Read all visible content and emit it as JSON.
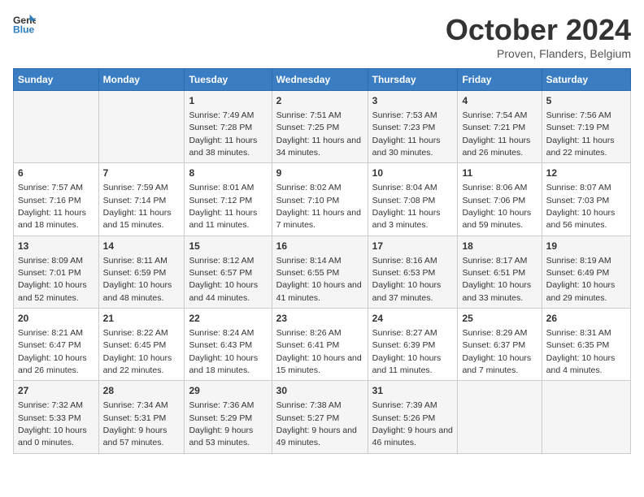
{
  "header": {
    "logo": {
      "general": "General",
      "blue": "Blue"
    },
    "month": "October 2024",
    "location": "Proven, Flanders, Belgium"
  },
  "weekdays": [
    "Sunday",
    "Monday",
    "Tuesday",
    "Wednesday",
    "Thursday",
    "Friday",
    "Saturday"
  ],
  "weeks": [
    [
      {
        "day": "",
        "info": ""
      },
      {
        "day": "",
        "info": ""
      },
      {
        "day": "1",
        "info": "Sunrise: 7:49 AM\nSunset: 7:28 PM\nDaylight: 11 hours and 38 minutes."
      },
      {
        "day": "2",
        "info": "Sunrise: 7:51 AM\nSunset: 7:25 PM\nDaylight: 11 hours and 34 minutes."
      },
      {
        "day": "3",
        "info": "Sunrise: 7:53 AM\nSunset: 7:23 PM\nDaylight: 11 hours and 30 minutes."
      },
      {
        "day": "4",
        "info": "Sunrise: 7:54 AM\nSunset: 7:21 PM\nDaylight: 11 hours and 26 minutes."
      },
      {
        "day": "5",
        "info": "Sunrise: 7:56 AM\nSunset: 7:19 PM\nDaylight: 11 hours and 22 minutes."
      }
    ],
    [
      {
        "day": "6",
        "info": "Sunrise: 7:57 AM\nSunset: 7:16 PM\nDaylight: 11 hours and 18 minutes."
      },
      {
        "day": "7",
        "info": "Sunrise: 7:59 AM\nSunset: 7:14 PM\nDaylight: 11 hours and 15 minutes."
      },
      {
        "day": "8",
        "info": "Sunrise: 8:01 AM\nSunset: 7:12 PM\nDaylight: 11 hours and 11 minutes."
      },
      {
        "day": "9",
        "info": "Sunrise: 8:02 AM\nSunset: 7:10 PM\nDaylight: 11 hours and 7 minutes."
      },
      {
        "day": "10",
        "info": "Sunrise: 8:04 AM\nSunset: 7:08 PM\nDaylight: 11 hours and 3 minutes."
      },
      {
        "day": "11",
        "info": "Sunrise: 8:06 AM\nSunset: 7:06 PM\nDaylight: 10 hours and 59 minutes."
      },
      {
        "day": "12",
        "info": "Sunrise: 8:07 AM\nSunset: 7:03 PM\nDaylight: 10 hours and 56 minutes."
      }
    ],
    [
      {
        "day": "13",
        "info": "Sunrise: 8:09 AM\nSunset: 7:01 PM\nDaylight: 10 hours and 52 minutes."
      },
      {
        "day": "14",
        "info": "Sunrise: 8:11 AM\nSunset: 6:59 PM\nDaylight: 10 hours and 48 minutes."
      },
      {
        "day": "15",
        "info": "Sunrise: 8:12 AM\nSunset: 6:57 PM\nDaylight: 10 hours and 44 minutes."
      },
      {
        "day": "16",
        "info": "Sunrise: 8:14 AM\nSunset: 6:55 PM\nDaylight: 10 hours and 41 minutes."
      },
      {
        "day": "17",
        "info": "Sunrise: 8:16 AM\nSunset: 6:53 PM\nDaylight: 10 hours and 37 minutes."
      },
      {
        "day": "18",
        "info": "Sunrise: 8:17 AM\nSunset: 6:51 PM\nDaylight: 10 hours and 33 minutes."
      },
      {
        "day": "19",
        "info": "Sunrise: 8:19 AM\nSunset: 6:49 PM\nDaylight: 10 hours and 29 minutes."
      }
    ],
    [
      {
        "day": "20",
        "info": "Sunrise: 8:21 AM\nSunset: 6:47 PM\nDaylight: 10 hours and 26 minutes."
      },
      {
        "day": "21",
        "info": "Sunrise: 8:22 AM\nSunset: 6:45 PM\nDaylight: 10 hours and 22 minutes."
      },
      {
        "day": "22",
        "info": "Sunrise: 8:24 AM\nSunset: 6:43 PM\nDaylight: 10 hours and 18 minutes."
      },
      {
        "day": "23",
        "info": "Sunrise: 8:26 AM\nSunset: 6:41 PM\nDaylight: 10 hours and 15 minutes."
      },
      {
        "day": "24",
        "info": "Sunrise: 8:27 AM\nSunset: 6:39 PM\nDaylight: 10 hours and 11 minutes."
      },
      {
        "day": "25",
        "info": "Sunrise: 8:29 AM\nSunset: 6:37 PM\nDaylight: 10 hours and 7 minutes."
      },
      {
        "day": "26",
        "info": "Sunrise: 8:31 AM\nSunset: 6:35 PM\nDaylight: 10 hours and 4 minutes."
      }
    ],
    [
      {
        "day": "27",
        "info": "Sunrise: 7:32 AM\nSunset: 5:33 PM\nDaylight: 10 hours and 0 minutes."
      },
      {
        "day": "28",
        "info": "Sunrise: 7:34 AM\nSunset: 5:31 PM\nDaylight: 9 hours and 57 minutes."
      },
      {
        "day": "29",
        "info": "Sunrise: 7:36 AM\nSunset: 5:29 PM\nDaylight: 9 hours and 53 minutes."
      },
      {
        "day": "30",
        "info": "Sunrise: 7:38 AM\nSunset: 5:27 PM\nDaylight: 9 hours and 49 minutes."
      },
      {
        "day": "31",
        "info": "Sunrise: 7:39 AM\nSunset: 5:26 PM\nDaylight: 9 hours and 46 minutes."
      },
      {
        "day": "",
        "info": ""
      },
      {
        "day": "",
        "info": ""
      }
    ]
  ]
}
